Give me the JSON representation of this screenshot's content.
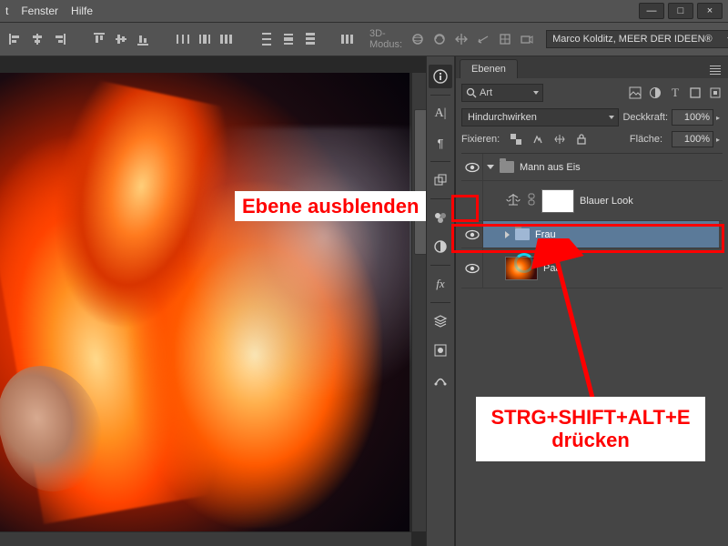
{
  "menubar": {
    "items": [
      "t",
      "Fenster",
      "Hilfe"
    ]
  },
  "window_controls": {
    "min": "—",
    "max": "□",
    "close": "×"
  },
  "optionsbar": {
    "mode3d_label": "3D-Modus:",
    "workspace_combo": "Marco Kolditz, MEER DER IDEEN®"
  },
  "dock_icons": [
    "info",
    "A-vert",
    "paragraph",
    "clone",
    "swatches",
    "adjust",
    "fx",
    "layers-ic",
    "channels",
    "paths"
  ],
  "panel": {
    "tab": "Ebenen",
    "search_label": "Art",
    "blend_mode": "Hindurchwirken",
    "opacity_label": "Deckkraft:",
    "opacity_value": "100%",
    "lock_label": "Fixieren:",
    "fill_label": "Fläche:",
    "fill_value": "100%"
  },
  "layers": [
    {
      "name": "Mann aus Eis",
      "type": "group",
      "visible": true,
      "open": true
    },
    {
      "name": "Blauer Look",
      "type": "adjustment",
      "visible": false,
      "indent": 1
    },
    {
      "name": "Frau",
      "type": "group",
      "visible": true,
      "open": false,
      "selected": true,
      "indent": 1
    },
    {
      "name": "Paa",
      "type": "pixel",
      "visible": true,
      "indent": 1
    }
  ],
  "annotations": {
    "hide_layer": "Ebene ausblenden",
    "shortcut": "STRG+SHIFT+ALT+E\ndrücken"
  }
}
